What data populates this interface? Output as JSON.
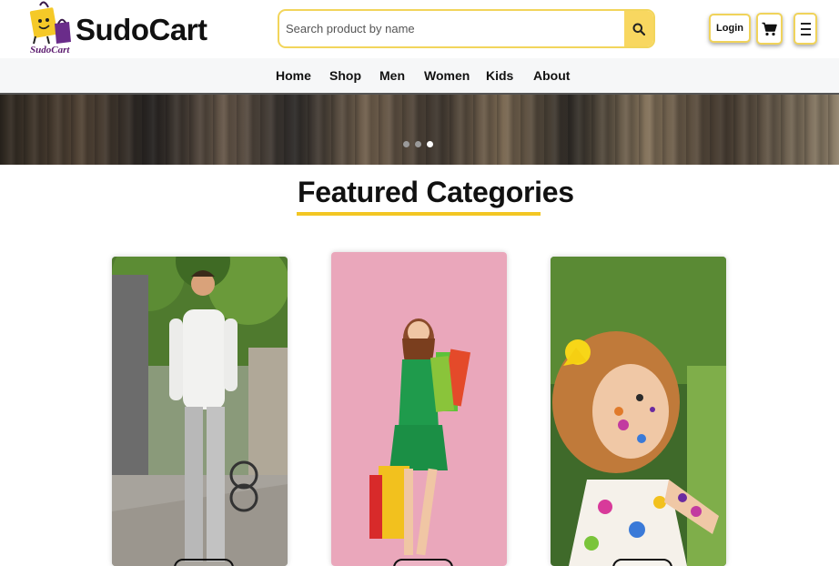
{
  "header": {
    "brand_name": "SudoCart",
    "logo_caption": "SudoCart",
    "search_placeholder": "Search product by name",
    "search_icon": "search-icon",
    "login_label": "Login",
    "cart_icon": "cart-icon",
    "menu_icon": "hamburger-menu-icon"
  },
  "nav": {
    "items": [
      {
        "label": "Home"
      },
      {
        "label": "Shop"
      },
      {
        "label": "Men"
      },
      {
        "label": "Women"
      },
      {
        "label": "Kids"
      },
      {
        "label": "About"
      }
    ]
  },
  "hero": {
    "slide_count": 3,
    "active_slide": 3
  },
  "featured": {
    "title": "Featured Categories",
    "cards": [
      {
        "image": "man in white shirt"
      },
      {
        "image": "woman with shopping bags"
      },
      {
        "image": "child with paint"
      }
    ]
  },
  "colors": {
    "accent": "#f3c623",
    "border_accent": "#f0d35a",
    "search_button": "#f8d760",
    "logo_caption": "#5b1a6e"
  }
}
